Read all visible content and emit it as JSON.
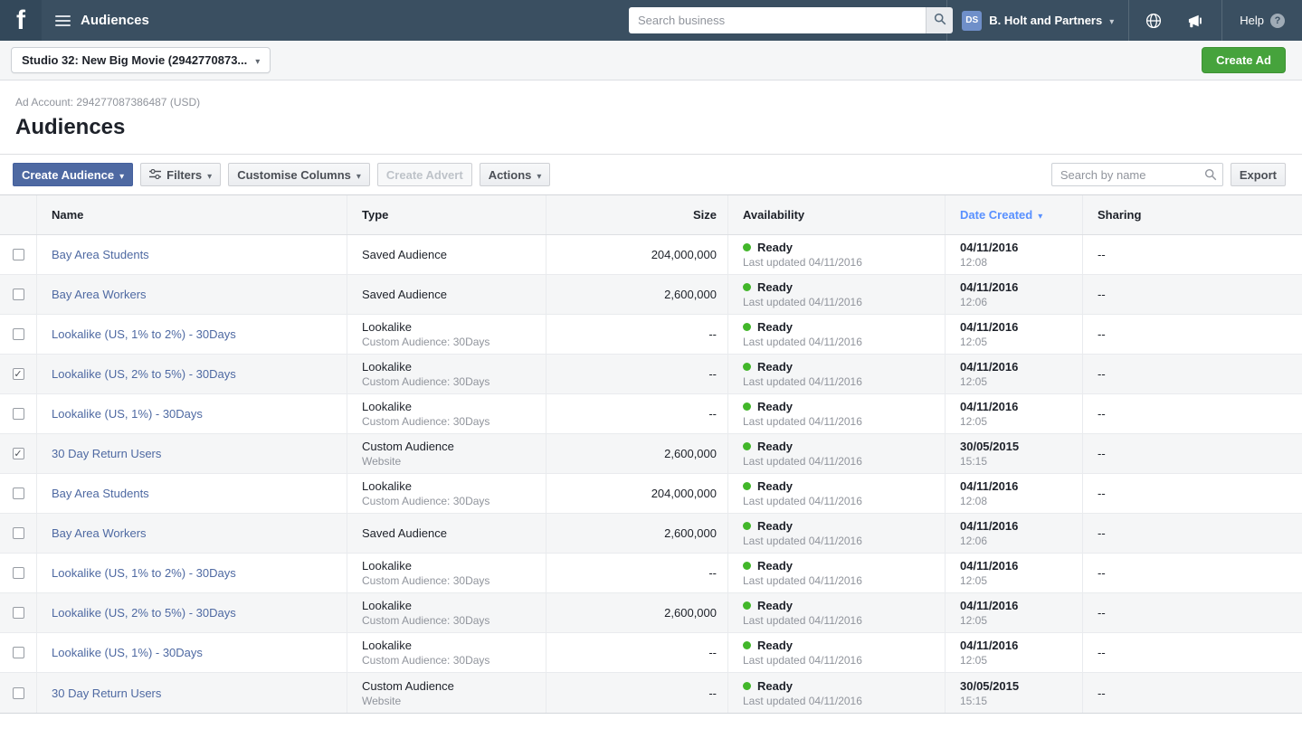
{
  "topbar": {
    "logo_letter": "f",
    "app_title": "Audiences",
    "search_placeholder": "Search business",
    "avatar_initials": "DS",
    "business_name": "B. Holt and Partners",
    "help_label": "Help",
    "help_icon": "?"
  },
  "subheader": {
    "account_selector": "Studio 32: New Big Movie (2942770873...",
    "create_ad": "Create Ad"
  },
  "page": {
    "ad_account": "Ad Account: 294277087386487 (USD)",
    "title": "Audiences"
  },
  "toolbar": {
    "create_audience": "Create Audience",
    "filters": "Filters",
    "customise_columns": "Customise Columns",
    "create_advert": "Create Advert",
    "actions": "Actions",
    "search_placeholder": "Search by name",
    "export": "Export"
  },
  "table": {
    "headers": {
      "name": "Name",
      "type": "Type",
      "size": "Size",
      "availability": "Availability",
      "date_created": "Date Created",
      "sharing": "Sharing"
    },
    "rows": [
      {
        "name": "Bay Area Students",
        "type": "Saved Audience",
        "type_sub": "",
        "size": "204,000,000",
        "status": "Ready",
        "status_sub": "Last updated 04/11/2016",
        "date": "04/11/2016",
        "time": "12:08",
        "sharing": "--",
        "checked": false
      },
      {
        "name": "Bay Area Workers",
        "type": "Saved Audience",
        "type_sub": "",
        "size": "2,600,000",
        "status": "Ready",
        "status_sub": "Last updated 04/11/2016",
        "date": "04/11/2016",
        "time": "12:06",
        "sharing": "--",
        "checked": false
      },
      {
        "name": "Lookalike (US, 1% to 2%) - 30Days",
        "type": "Lookalike",
        "type_sub": "Custom Audience: 30Days",
        "size": "--",
        "status": "Ready",
        "status_sub": "Last updated 04/11/2016",
        "date": "04/11/2016",
        "time": "12:05",
        "sharing": "--",
        "checked": false
      },
      {
        "name": "Lookalike (US, 2% to 5%) - 30Days",
        "type": "Lookalike",
        "type_sub": "Custom Audience: 30Days",
        "size": "--",
        "status": "Ready",
        "status_sub": "Last updated 04/11/2016",
        "date": "04/11/2016",
        "time": "12:05",
        "sharing": "--",
        "checked": true
      },
      {
        "name": "Lookalike (US, 1%) - 30Days",
        "type": "Lookalike",
        "type_sub": "Custom Audience: 30Days",
        "size": "--",
        "status": "Ready",
        "status_sub": "Last updated 04/11/2016",
        "date": "04/11/2016",
        "time": "12:05",
        "sharing": "--",
        "checked": false
      },
      {
        "name": "30 Day Return Users",
        "type": "Custom Audience",
        "type_sub": "Website",
        "size": "2,600,000",
        "status": "Ready",
        "status_sub": "Last updated 04/11/2016",
        "date": "30/05/2015",
        "time": "15:15",
        "sharing": "--",
        "checked": true
      },
      {
        "name": "Bay Area Students",
        "type": "Lookalike",
        "type_sub": "Custom Audience: 30Days",
        "size": "204,000,000",
        "status": "Ready",
        "status_sub": "Last updated 04/11/2016",
        "date": "04/11/2016",
        "time": "12:08",
        "sharing": "--",
        "checked": false
      },
      {
        "name": "Bay Area Workers",
        "type": "Saved Audience",
        "type_sub": "",
        "size": "2,600,000",
        "status": "Ready",
        "status_sub": "Last updated 04/11/2016",
        "date": "04/11/2016",
        "time": "12:06",
        "sharing": "--",
        "checked": false
      },
      {
        "name": "Lookalike (US, 1% to 2%) - 30Days",
        "type": "Lookalike",
        "type_sub": "Custom Audience: 30Days",
        "size": "--",
        "status": "Ready",
        "status_sub": "Last updated 04/11/2016",
        "date": "04/11/2016",
        "time": "12:05",
        "sharing": "--",
        "checked": false
      },
      {
        "name": "Lookalike (US, 2% to 5%) - 30Days",
        "type": "Lookalike",
        "type_sub": "Custom Audience: 30Days",
        "size": "2,600,000",
        "status": "Ready",
        "status_sub": "Last updated 04/11/2016",
        "date": "04/11/2016",
        "time": "12:05",
        "sharing": "--",
        "checked": false
      },
      {
        "name": "Lookalike (US, 1%) - 30Days",
        "type": "Lookalike",
        "type_sub": "Custom Audience: 30Days",
        "size": "--",
        "status": "Ready",
        "status_sub": "Last updated 04/11/2016",
        "date": "04/11/2016",
        "time": "12:05",
        "sharing": "--",
        "checked": false
      },
      {
        "name": "30 Day Return Users",
        "type": "Custom Audience",
        "type_sub": "Website",
        "size": "--",
        "status": "Ready",
        "status_sub": "Last updated 04/11/2016",
        "date": "30/05/2015",
        "time": "15:15",
        "sharing": "--",
        "checked": false
      }
    ]
  },
  "colors": {
    "topbar_bg": "#3a4f61",
    "accent_blue": "#4e69a2",
    "sorted_header_blue": "#5890ff",
    "create_ad_green": "#46a33c",
    "status_ready_green": "#42b72a"
  }
}
